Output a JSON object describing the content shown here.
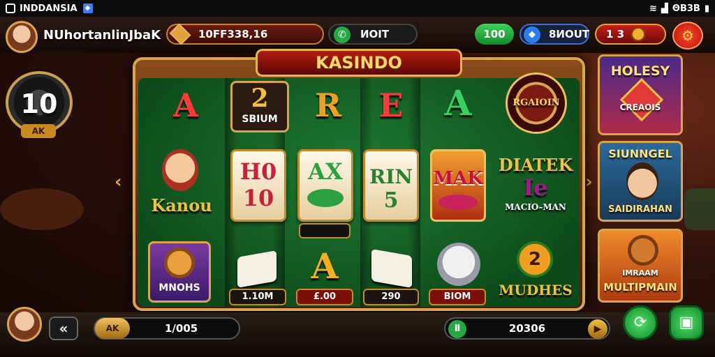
{
  "status_bar": {
    "app_name": "INDDANSIA",
    "time": "ΘB3B"
  },
  "header": {
    "username": "NUhortanlinJbaK",
    "coin_balance": "10FF338,16",
    "mot_label": "ИOIT",
    "green_value": "100",
    "blue_value": "8ИOUT",
    "red_value": "1   3"
  },
  "level": {
    "number": "10",
    "badge": "AK"
  },
  "machine": {
    "title": "KASINDO",
    "row1": {
      "a1": "A",
      "c2_big": "2",
      "c2_small": "SBIUM",
      "r": "R",
      "e": "E",
      "a2": "A",
      "roulette": "RGAIOIN"
    },
    "row2": {
      "kanon": "Kanou",
      "slot1_top": "H0",
      "slot1_bottom": "10",
      "slot2_top": "AX",
      "slot3_top": "RIN",
      "slot3_bottom": "5",
      "slot4_top": "MAK",
      "dialek": "DIATEK",
      "dialek_num": "Ie",
      "dialek_sub": "MACIO–MAN"
    },
    "row3": {
      "nohs_title": "MNOHS",
      "a_letter": "A",
      "mudhes": "MUDHES",
      "mudhes_num": "2"
    },
    "labels": [
      "1.10M",
      "£.00",
      "290",
      "BIOM"
    ]
  },
  "thumbnails": [
    {
      "title": "HOLESY",
      "subtitle": "CREAOIS"
    },
    {
      "title": "SIUNNGEL",
      "subtitle": "SAIDIRAHAN"
    },
    {
      "title": "MULTIPMAIN",
      "subtitle": "IMRAAM"
    }
  ],
  "bottom_bar": {
    "bet_value": "1/005",
    "win_value": "20306",
    "left_badge": "AK"
  },
  "colors": {
    "felt": "#1f7a32",
    "gold": "#d9a450",
    "red": "#b31c12",
    "green_button": "#27a844"
  }
}
